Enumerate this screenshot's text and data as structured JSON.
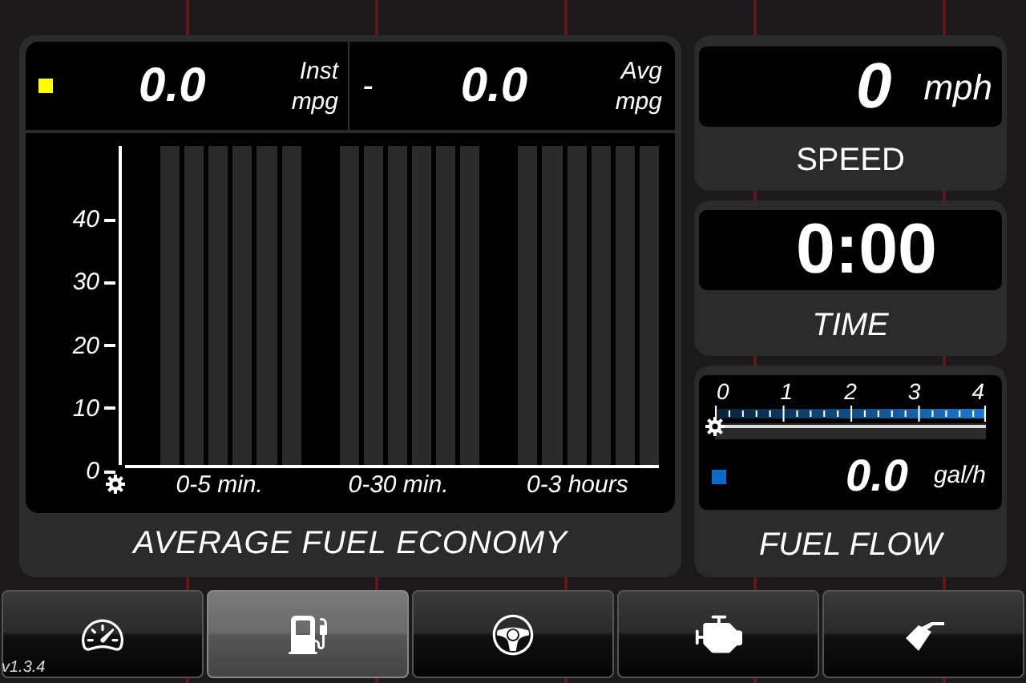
{
  "economy": {
    "instant": {
      "value": "0.0",
      "unit_top": "Inst",
      "unit_bottom": "mpg"
    },
    "separator": "-",
    "average": {
      "value": "0.0",
      "unit_top": "Avg",
      "unit_bottom": "mpg"
    },
    "y_ticks": [
      "40",
      "30",
      "20",
      "10",
      "0"
    ],
    "periods": [
      "0-5 min.",
      "0-30 min.",
      "0-3 hours"
    ],
    "title": "AVERAGE FUEL ECONOMY"
  },
  "speed": {
    "value": "0",
    "unit": "mph",
    "title": "SPEED"
  },
  "time": {
    "value": "0:00",
    "title": "TIME"
  },
  "fuel_flow": {
    "scale": [
      "0",
      "1",
      "2",
      "3",
      "4"
    ],
    "level": 0,
    "value": "0.0",
    "unit": "gal/h",
    "title": "FUEL FLOW"
  },
  "nav": [
    {
      "kind": "gauge",
      "selected": false
    },
    {
      "kind": "pump",
      "selected": true
    },
    {
      "kind": "steering",
      "selected": false
    },
    {
      "kind": "engine",
      "selected": false
    },
    {
      "kind": "nozzle",
      "selected": false
    }
  ],
  "version": "v1.3.4"
}
